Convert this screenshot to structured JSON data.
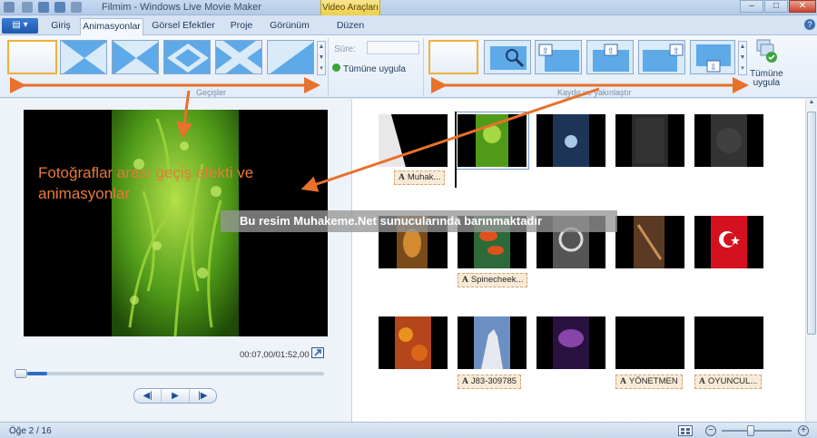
{
  "window": {
    "title": "Filmim - Windows Live Movie Maker",
    "contextual_group": "Video Araçları",
    "controls": {
      "minimize": "–",
      "maximize": "□",
      "close": "✕",
      "help": "?"
    }
  },
  "tabs": [
    {
      "label": "Giriş"
    },
    {
      "label": "Animasyonlar",
      "active": true
    },
    {
      "label": "Görsel Efektler"
    },
    {
      "label": "Proje"
    },
    {
      "label": "Görünüm"
    },
    {
      "label": "Düzen"
    }
  ],
  "ribbon": {
    "transitions_group": "Geçişler",
    "duration_label": "Süre:",
    "duration_value": "",
    "apply_all_transitions": "Tümüne uygula",
    "pan_zoom_group": "Kaydır ve yakınlaştır",
    "apply_all_pan_line1": "Tümüne",
    "apply_all_pan_line2": "uygula"
  },
  "preview": {
    "overlay_text": "Fotoğraflar arası geçiş efekti ve animasyonlar",
    "timecode": "00:07,00/01:52,00",
    "seek_progress": 0.067
  },
  "transport": {
    "prev": "◀|",
    "play": "▶",
    "next": "|▶"
  },
  "storyboard": {
    "captions": [
      {
        "label": "Muhak..."
      },
      {
        "label": "Spinecheek..."
      },
      {
        "label": "J83-309785"
      },
      {
        "label": "YÖNETMEN"
      },
      {
        "label": "OYUNCUL..."
      }
    ]
  },
  "watermark": "Bu resim Muhakeme.Net sunucularında barınmaktadır",
  "status": {
    "item_count": "Öğe 2 / 16"
  },
  "colors": {
    "accent": "#e8712b",
    "ribbon_bg": "#e3ecf7",
    "contextual": "#eccf4d",
    "flag_red": "#d4121f"
  }
}
